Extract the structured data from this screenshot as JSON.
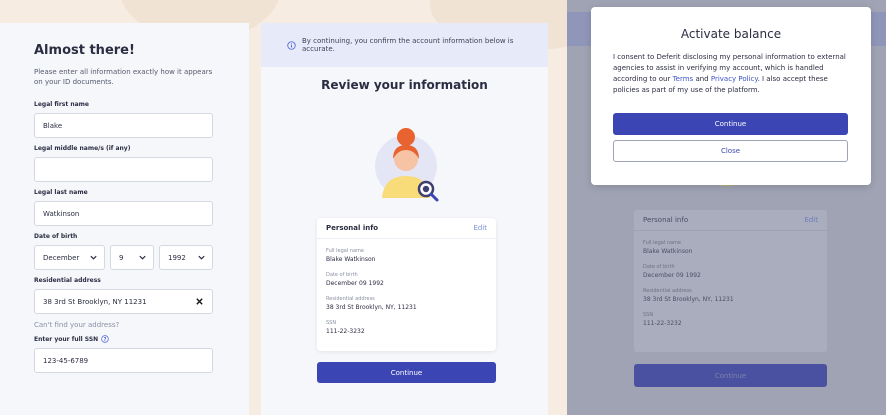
{
  "form": {
    "title": "Almost there!",
    "subtitle": "Please enter all information exactly how it appears on your ID documents.",
    "first_name_label": "Legal first name",
    "first_name_value": "Blake",
    "middle_name_label": "Legal middle name/s (if any)",
    "middle_name_value": "",
    "last_name_label": "Legal last name",
    "last_name_value": "Watkinson",
    "dob_label": "Date of birth",
    "dob_month": "December",
    "dob_day": "9",
    "dob_year": "1992",
    "address_label": "Residential address",
    "address_value": "38 3rd St Brooklyn, NY 11231",
    "cant_find": "Can't find your address?",
    "ssn_label": "Enter your full SSN",
    "ssn_value": "123-45-6789"
  },
  "review": {
    "notice": "By continuing, you confirm the account information below is accurate.",
    "title": "Review your information",
    "card_title": "Personal info",
    "edit_label": "Edit",
    "items": [
      {
        "label": "Full legal name",
        "value": "Blake Watkinson"
      },
      {
        "label": "Date of birth",
        "value": "December 09 1992"
      },
      {
        "label": "Residential address",
        "value": "38 3rd St Brooklyn, NY, 11231"
      },
      {
        "label": "SSN",
        "value": "111-22-3232"
      }
    ],
    "continue_label": "Continue"
  },
  "modal": {
    "title": "Activate balance",
    "text_before": "I consent to Deferit disclosing my personal information to external agencies to assist in verifying my account, which is handled according to our ",
    "terms_link": "Terms",
    "and": " and ",
    "privacy_link": "Privacy Policy",
    "text_after": ". I also accept these policies as part of my use of the platform.",
    "continue_label": "Continue",
    "close_label": "Close"
  },
  "colors": {
    "primary": "#3b46b4",
    "link": "#3b52c8",
    "background": "#f6ece2"
  }
}
